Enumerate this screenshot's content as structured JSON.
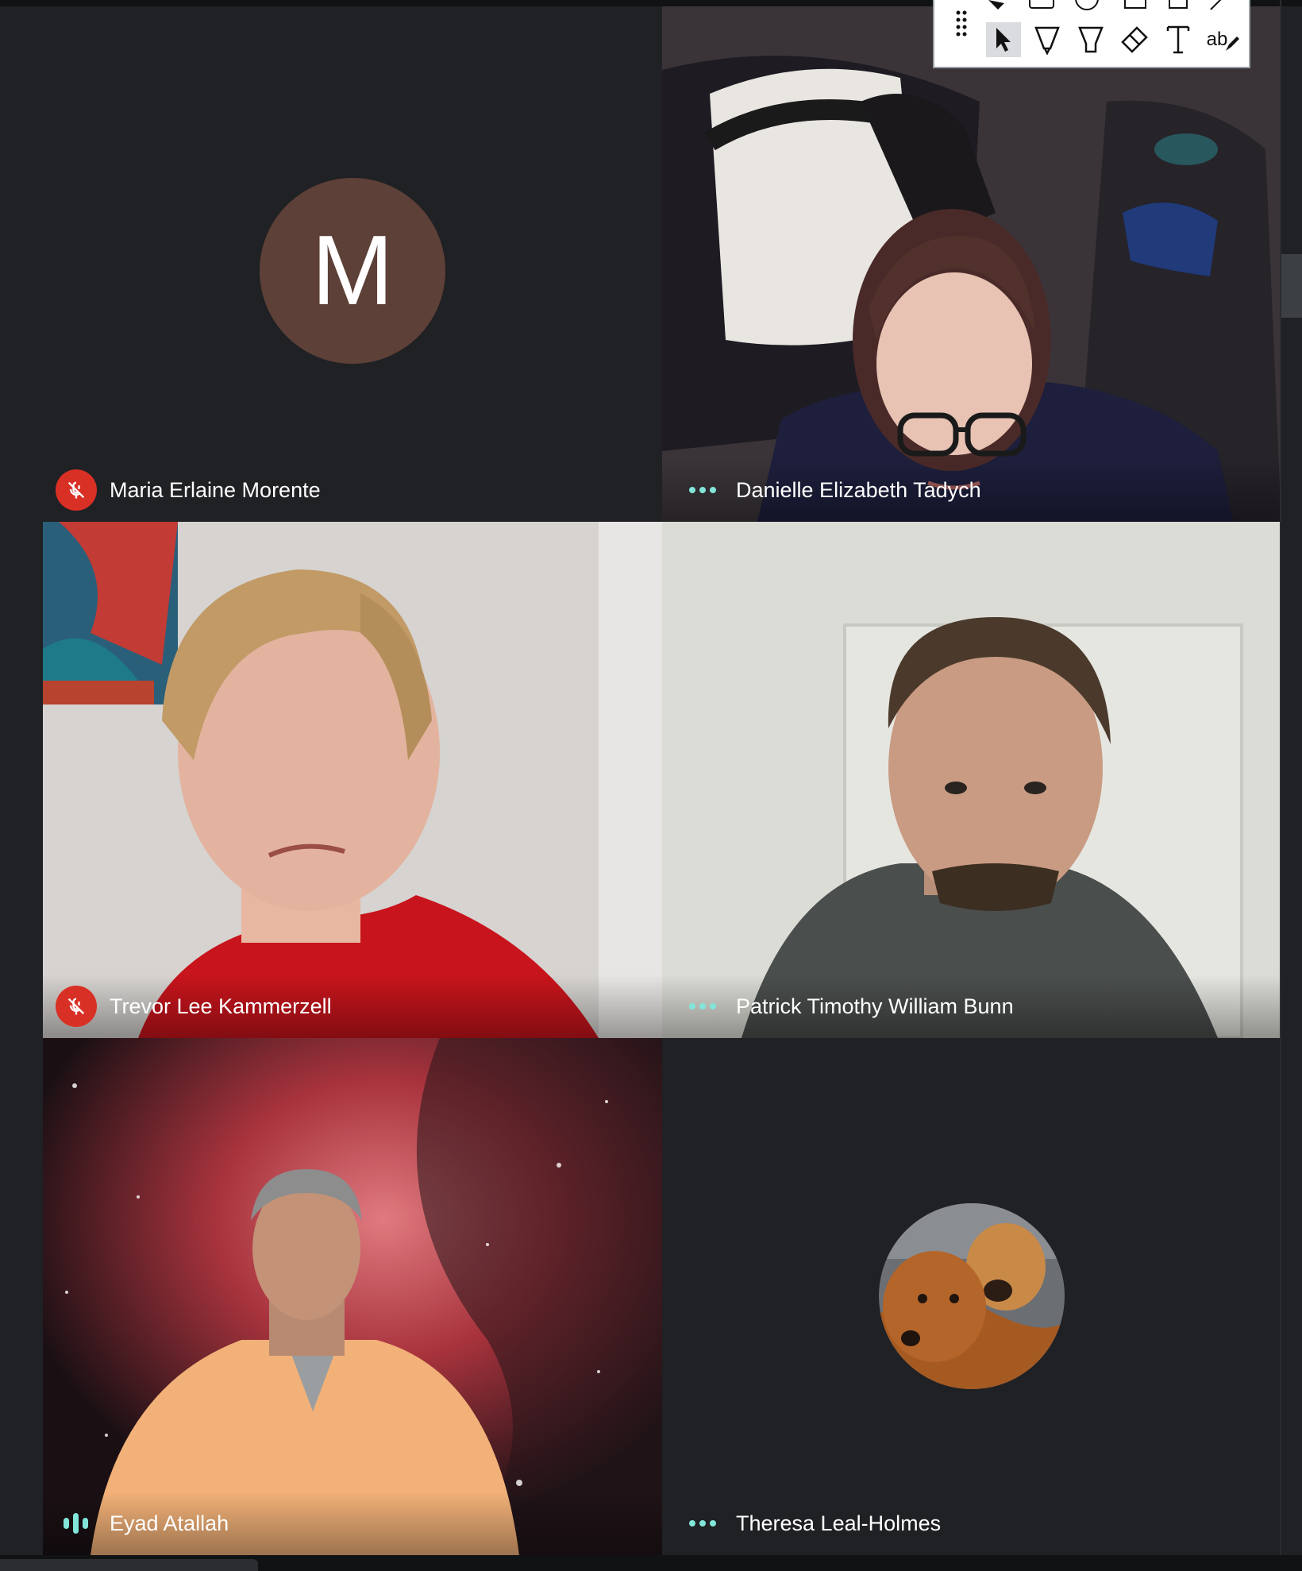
{
  "participants": [
    {
      "name": "Maria Erlaine Morente",
      "status_icon": "mic-off-icon",
      "avatar_letter": "M",
      "avatar_color": "#5d4037"
    },
    {
      "name": "Danielle Elizabeth Tadych",
      "status_icon": "more-options-icon"
    },
    {
      "name": "Trevor Lee Kammerzell",
      "status_icon": "mic-off-icon"
    },
    {
      "name": "Patrick Timothy William Bunn",
      "status_icon": "more-options-icon"
    },
    {
      "name": "Eyad Atallah",
      "status_icon": "speaking-indicator-icon"
    },
    {
      "name": "Theresa Leal-Holmes",
      "status_icon": "more-options-icon"
    }
  ],
  "annotation_toolbar": {
    "tools": [
      "drag-handle-icon",
      "select-pointer-icon",
      "highlighter-icon",
      "marker-icon",
      "eraser-icon",
      "text-tool-icon"
    ],
    "text_tool_label": "ab",
    "selected_tool": "select-pointer-icon"
  },
  "colors": {
    "background": "#202124",
    "mute_red": "#d93025",
    "dots_teal": "#81e6d9",
    "speaking_teal": "#81e6d9"
  }
}
